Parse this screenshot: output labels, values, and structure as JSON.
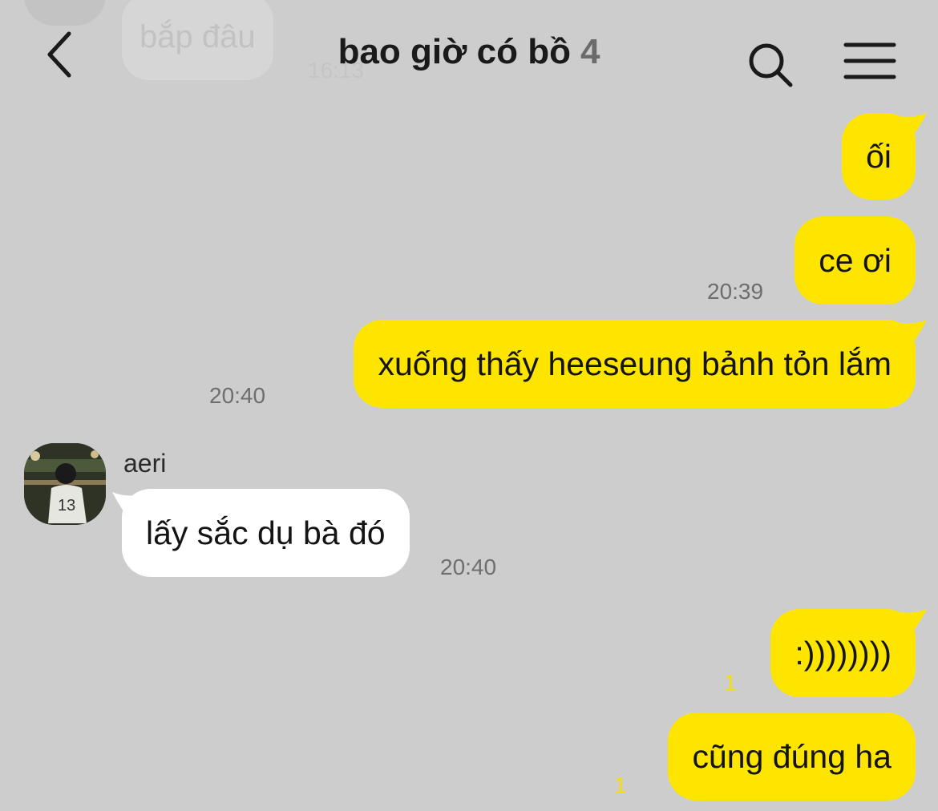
{
  "header": {
    "title": "bao giờ có bồ",
    "member_count": "4"
  },
  "ghost_message": {
    "text": "bắp đâu",
    "time": "16:13"
  },
  "messages": [
    {
      "id": "m1",
      "text": "ối",
      "sender": "me"
    },
    {
      "id": "m2",
      "text": "ce ơi",
      "sender": "me",
      "time": "20:39"
    },
    {
      "id": "m3",
      "text": "xuống thấy heeseung bảnh tỏn lắm",
      "sender": "me",
      "time": "20:40"
    },
    {
      "id": "m4",
      "text": "lấy sắc dụ bà đó",
      "sender": "aeri",
      "sender_name": "aeri",
      "time": "20:40"
    },
    {
      "id": "m5",
      "text": ":))))))))",
      "sender": "me",
      "unread": "1"
    },
    {
      "id": "m6",
      "text": "cũng đúng ha",
      "sender": "me",
      "unread": "1"
    }
  ],
  "icons": {
    "back": "chevron-left-icon",
    "search": "search-icon",
    "menu": "hamburger-menu-icon"
  },
  "colors": {
    "background": "#cdcdcd",
    "my_bubble": "#fee500",
    "their_bubble": "#ffffff",
    "unread_count": "#f5df00"
  }
}
